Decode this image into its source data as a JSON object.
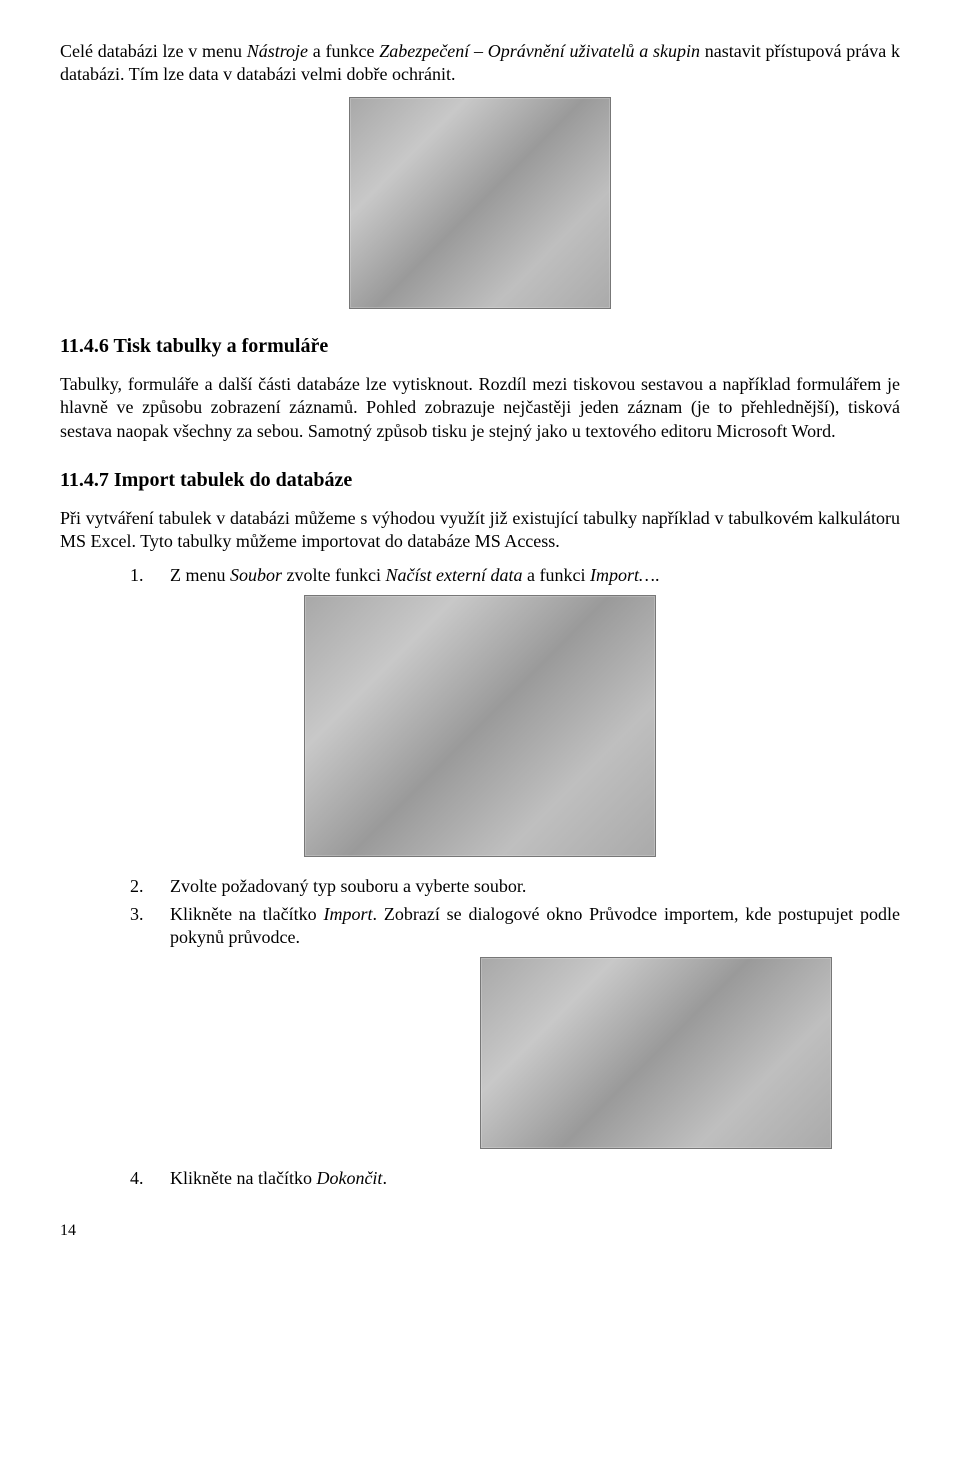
{
  "intro_para_pre": "Celé databázi lze v menu ",
  "intro_menu1": "Nástroje",
  "intro_mid1": " a funkce ",
  "intro_menu2": "Zabezpečení – Oprávnění uživatelů a skupin",
  "intro_mid2": " nastavit přístupová práva k databázi. Tím lze data v databázi velmi dobře ochránit.",
  "h_1146": "11.4.6 Tisk tabulky a formuláře",
  "p_1146": "Tabulky, formuláře a další části databáze lze vytisknout. Rozdíl mezi tiskovou sestavou a například formulářem je hlavně ve způsobu zobrazení záznamů. Pohled zobrazuje nejčastěji jeden záznam (je to přehlednější), tisková sestava naopak všechny za sebou. Samotný způsob tisku je stejný jako u textového editoru Microsoft Word.",
  "h_1147": "11.4.7 Import tabulek do databáze",
  "p_1147": "Při vytváření tabulek v databázi můžeme s výhodou využít již existující tabulky například v tabulkovém kalkulátoru MS Excel. Tyto tabulky můžeme importovat do databáze MS Access.",
  "step1_num": "1.",
  "step1_pre": "Z menu ",
  "step1_m1": "Soubor",
  "step1_mid1": " zvolte funkci ",
  "step1_m2": "Načíst externí data",
  "step1_mid2": " a funkci ",
  "step1_m3": "Import…",
  "step1_post": ".",
  "step2_num": "2.",
  "step2_txt": "Zvolte požadovaný typ souboru a vyberte soubor.",
  "step3_num": "3.",
  "step3_pre": "Klikněte na tlačítko ",
  "step3_m1": "Import",
  "step3_post": ". Zobrazí se dialogové okno Průvodce importem, kde postupujet podle pokynů průvodce.",
  "step4_num": "4.",
  "step4_pre": "Klikněte na tlačítko ",
  "step4_m1": "Dokončit",
  "step4_post": ".",
  "page_number": "14"
}
